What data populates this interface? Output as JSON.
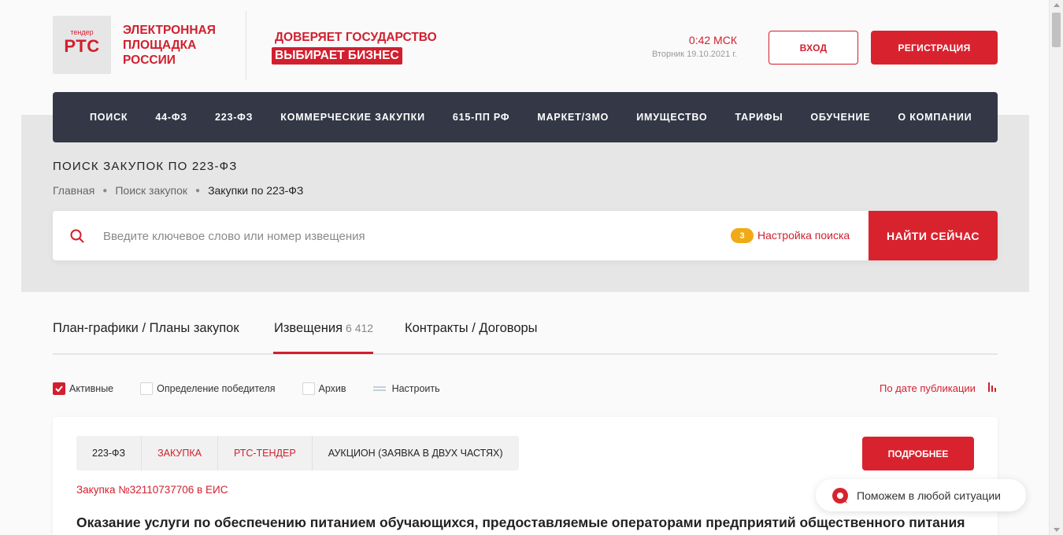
{
  "header": {
    "logo_small": "тендер",
    "logo_big": "РТС",
    "brand": "ЭЛЕКТРОННАЯ ПЛОЩАДКА РОССИИ",
    "slogan_line1": "ДОВЕРЯЕТ ГОСУДАРСТВО",
    "slogan_line2": "ВЫБИРАЕТ БИЗНЕС",
    "time": "0:42 МСК",
    "date": "Вторник 19.10.2021 г.",
    "login_label": "ВХОД",
    "register_label": "РЕГИСТРАЦИЯ"
  },
  "nav": {
    "items": [
      {
        "label": "ПОИСК"
      },
      {
        "label": "44-ФЗ"
      },
      {
        "label": "223-ФЗ"
      },
      {
        "label": "КОММЕРЧЕСКИЕ ЗАКУПКИ"
      },
      {
        "label": "615-ПП РФ"
      },
      {
        "label": "МАРКЕТ/ЗМО"
      },
      {
        "label": "ИМУЩЕСТВО"
      },
      {
        "label": "ТАРИФЫ"
      },
      {
        "label": "ОБУЧЕНИЕ"
      },
      {
        "label": "О КОМПАНИИ"
      }
    ]
  },
  "page": {
    "title": "ПОИСК ЗАКУПОК ПО 223-ФЗ",
    "breadcrumbs": [
      "Главная",
      "Поиск закупок",
      "Закупки по 223-ФЗ"
    ]
  },
  "search": {
    "placeholder": "Введите ключевое слово или номер извещения",
    "value": "",
    "settings_count": "3",
    "settings_label": "Настройка поиска",
    "submit_label": "НАЙТИ СЕЙЧАС"
  },
  "tabs": {
    "items": [
      {
        "label": "План-графики / Планы закупок",
        "count": ""
      },
      {
        "label": "Извещения",
        "count": "6 412"
      },
      {
        "label": "Контракты / Договоры",
        "count": ""
      }
    ],
    "active_index": 1
  },
  "filters": {
    "active_label": "Активные",
    "active_checked": true,
    "winner_label": "Определение победителя",
    "winner_checked": false,
    "archive_label": "Архив",
    "archive_checked": false,
    "configure_label": "Настроить",
    "sort_label": "По дате публикации"
  },
  "card": {
    "tags": [
      "223-ФЗ",
      "ЗАКУПКА",
      "РТС-ТЕНДЕР",
      "АУКЦИОН (ЗАЯВКА В ДВУХ ЧАСТЯХ)"
    ],
    "more_label": "ПОДРОБНЕЕ",
    "number": "Закупка №32110737706 в ЕИС",
    "title": "Оказание услуги по обеспечению питанием обучающихся, предоставляемые операторами предприятий общественного питания"
  },
  "help": {
    "text": "Поможем в любой ситуации"
  },
  "colors": {
    "accent": "#d8232f",
    "nav_bg": "#343746",
    "badge": "#f1aa15",
    "band_bg": "#e6e6e6"
  },
  "icons": {
    "search": "search-icon",
    "tune": "tune-icon",
    "sort": "bar-chart-icon",
    "help": "chat-bubble-icon",
    "check": "check-icon"
  }
}
